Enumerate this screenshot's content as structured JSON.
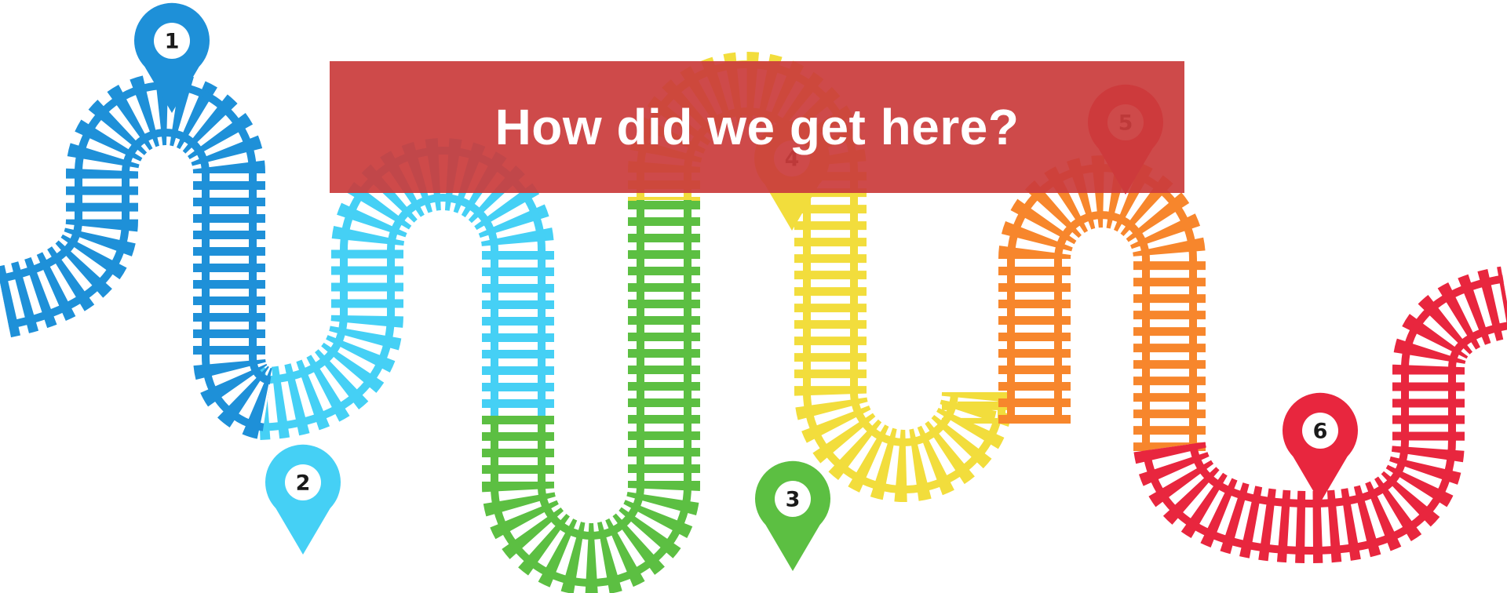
{
  "banner": {
    "title": "How did we get here?"
  },
  "colors": {
    "blue": "#1e90d8",
    "cyan": "#45d0f5",
    "green": "#5cbf42",
    "yellow": "#f2dd3c",
    "orange": "#f7862c",
    "red": "#e8263e",
    "banner": "#ca3c3c"
  },
  "milestones": [
    {
      "label": "1",
      "color": "blue"
    },
    {
      "label": "2",
      "color": "cyan"
    },
    {
      "label": "3",
      "color": "green"
    },
    {
      "label": "4",
      "color": "yellow"
    },
    {
      "label": "5",
      "color": "red"
    },
    {
      "label": "6",
      "color": "red"
    }
  ]
}
